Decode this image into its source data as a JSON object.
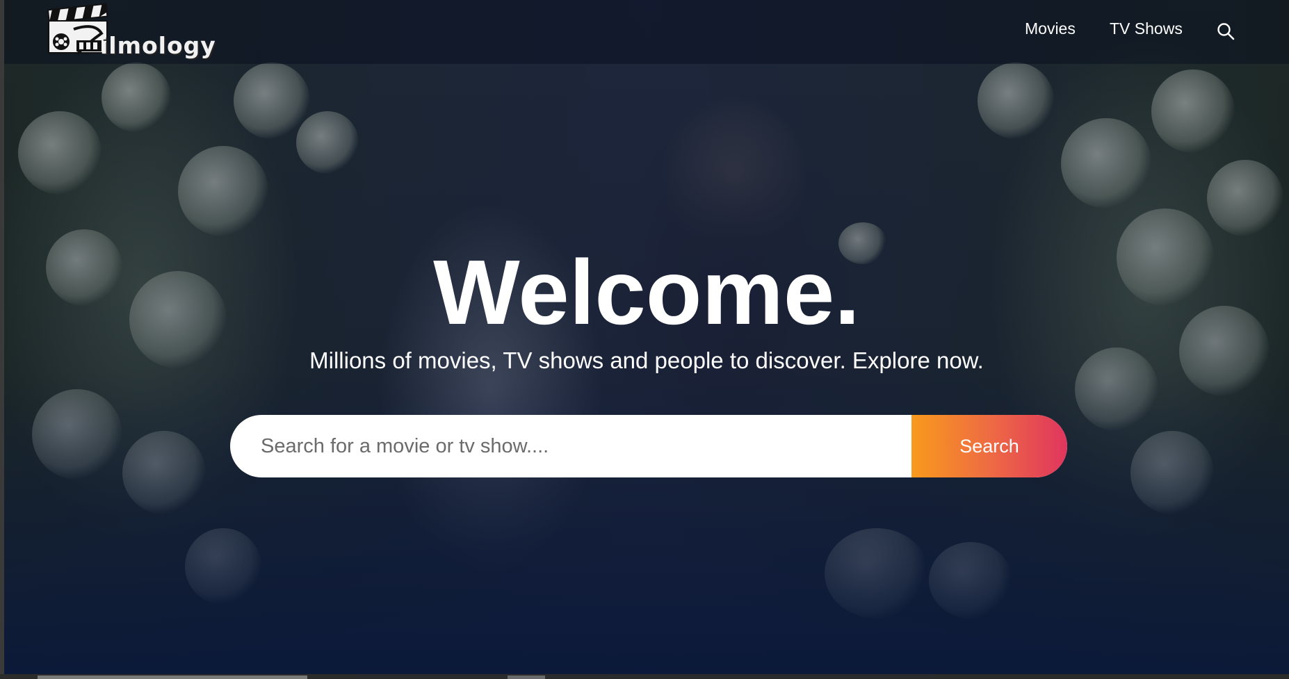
{
  "header": {
    "logo_text": "ilmology",
    "nav": {
      "movies": "Movies",
      "tv_shows": "TV Shows"
    },
    "search_icon": "search-icon"
  },
  "hero": {
    "title": "Welcome.",
    "subtitle": "Millions of movies, TV shows and people to discover. Explore now."
  },
  "search": {
    "placeholder": "Search for a movie or tv show....",
    "value": "",
    "button_label": "Search"
  },
  "colors": {
    "search_gradient_start": "#f89a1c",
    "search_gradient_end": "#e0355e",
    "overlay": "#0a183a"
  }
}
